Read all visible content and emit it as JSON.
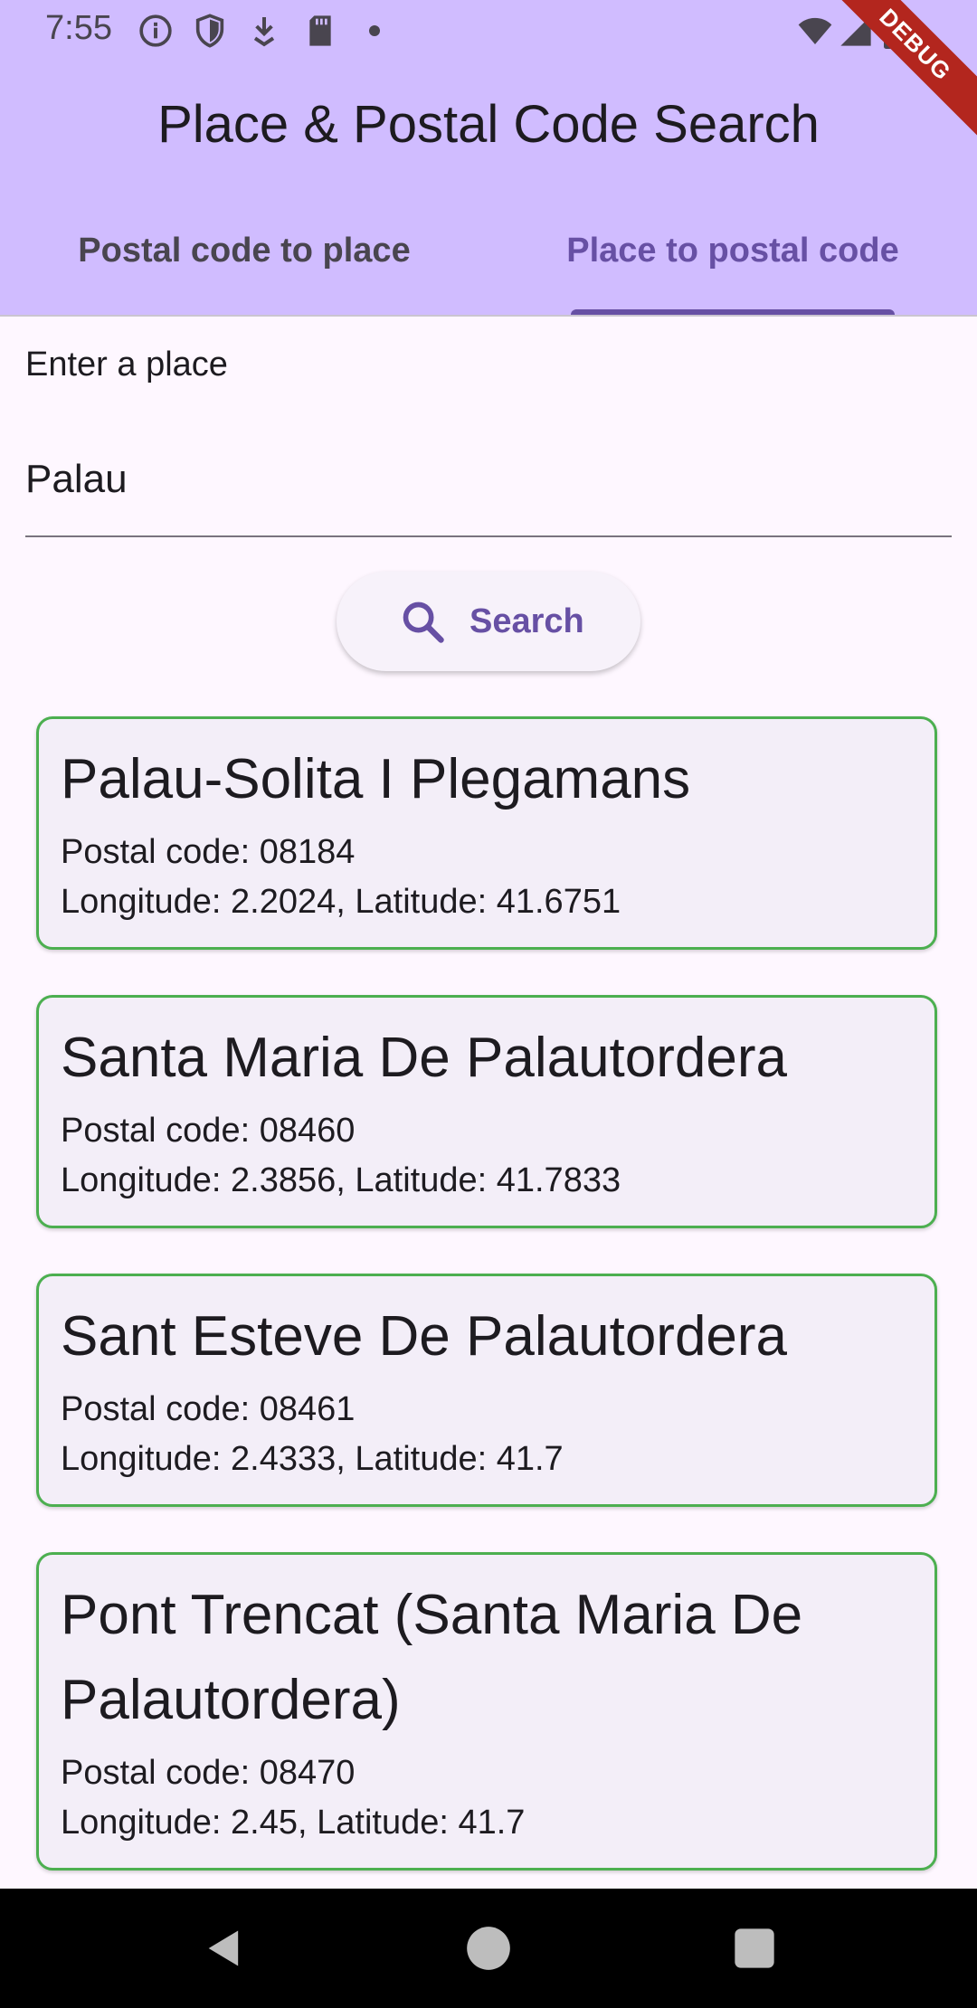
{
  "status_bar": {
    "time": "7:55",
    "icons": [
      "info-icon",
      "shield-icon",
      "download-icon",
      "sd-card-icon",
      "notification-dot-icon",
      "wifi-icon",
      "signal-icon",
      "battery-icon"
    ]
  },
  "debug_banner": "DEBUG",
  "app_bar": {
    "title": "Place & Postal Code Search"
  },
  "tabs": [
    {
      "label": "Postal code to place",
      "selected": false
    },
    {
      "label": "Place to postal code",
      "selected": true
    }
  ],
  "search_form": {
    "label": "Enter a place",
    "value": "Palau",
    "button_label": "Search",
    "button_icon": "search-icon"
  },
  "results": [
    {
      "name": "Palau-Solita I Plegamans",
      "postal_code": "Postal code: 08184",
      "coordinates": "Longitude: 2.2024, Latitude: 41.6751"
    },
    {
      "name": "Santa Maria De Palautordera",
      "postal_code": "Postal code: 08460",
      "coordinates": "Longitude: 2.3856, Latitude: 41.7833"
    },
    {
      "name": "Sant Esteve De Palautordera",
      "postal_code": "Postal code: 08461",
      "coordinates": "Longitude: 2.4333, Latitude: 41.7"
    },
    {
      "name_line1": "Pont Trencat (Santa Maria De",
      "name_line2": "Palautordera)",
      "postal_code": "Postal code: 08470",
      "coordinates": "Longitude: 2.45, Latitude: 41.7"
    }
  ],
  "nav_bar": {
    "buttons": [
      "back-icon",
      "home-icon",
      "recents-icon"
    ]
  },
  "colors": {
    "app_bar": "#d0bcff",
    "primary": "#6750a4",
    "card_border": "#4caf50",
    "card_background": "#f3eef8",
    "background": "#fef7ff"
  }
}
